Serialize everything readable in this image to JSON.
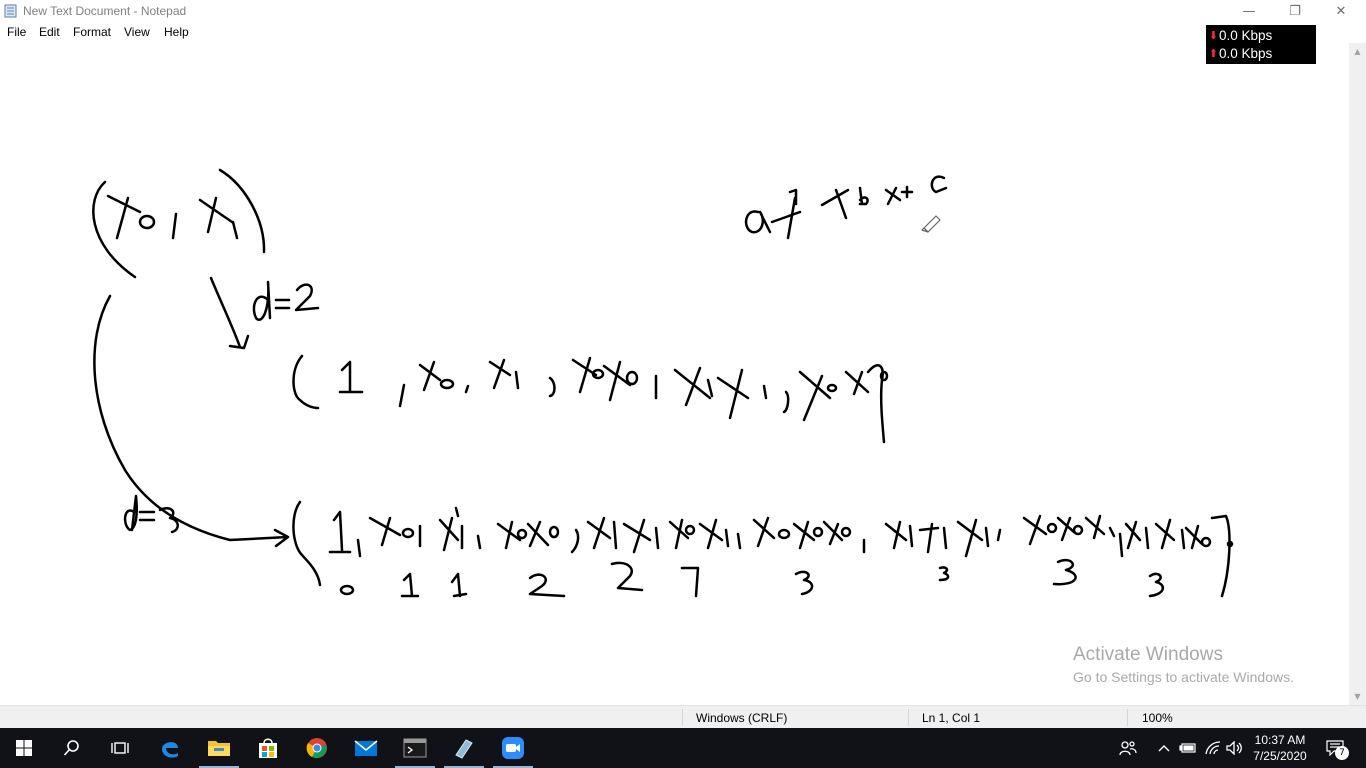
{
  "window": {
    "title": "New Text Document - Notepad",
    "minimize_glyph": "—",
    "restore_glyph": "❐",
    "close_glyph": "✕"
  },
  "menu": [
    {
      "label": "File"
    },
    {
      "label": "Edit"
    },
    {
      "label": "Format"
    },
    {
      "label": "View"
    },
    {
      "label": "Help"
    }
  ],
  "net_meter": {
    "down": "0.0 Kbps",
    "up": "0.0 Kbps",
    "down_arrow": "⬇",
    "up_arrow": "⬆",
    "arrow_color": "#ff2a2a"
  },
  "editor": {
    "content": ""
  },
  "watermark": {
    "title": "Activate Windows",
    "subtitle": "Go to Settings to activate Windows."
  },
  "status": {
    "line_ending": "Windows (CRLF)",
    "position": "Ln 1, Col 1",
    "zoom": "100%"
  },
  "taskbar": {
    "icons": [
      "windows-start-icon",
      "search-icon",
      "task-view-icon",
      "edge-icon",
      "file-explorer-icon",
      "microsoft-store-icon",
      "chrome-icon",
      "mail-icon",
      "terminal-icon",
      "pen-tablet-icon",
      "zoom-icon"
    ],
    "active": [
      "file-explorer-icon",
      "terminal-icon",
      "pen-tablet-icon",
      "zoom-icon"
    ]
  },
  "clock": {
    "time": "10:37 AM",
    "date": "7/25/2020"
  },
  "notifications": {
    "count": "7"
  },
  "colors": {
    "taskbar_bg": "#101217",
    "accent_blue": "#0078d7"
  }
}
